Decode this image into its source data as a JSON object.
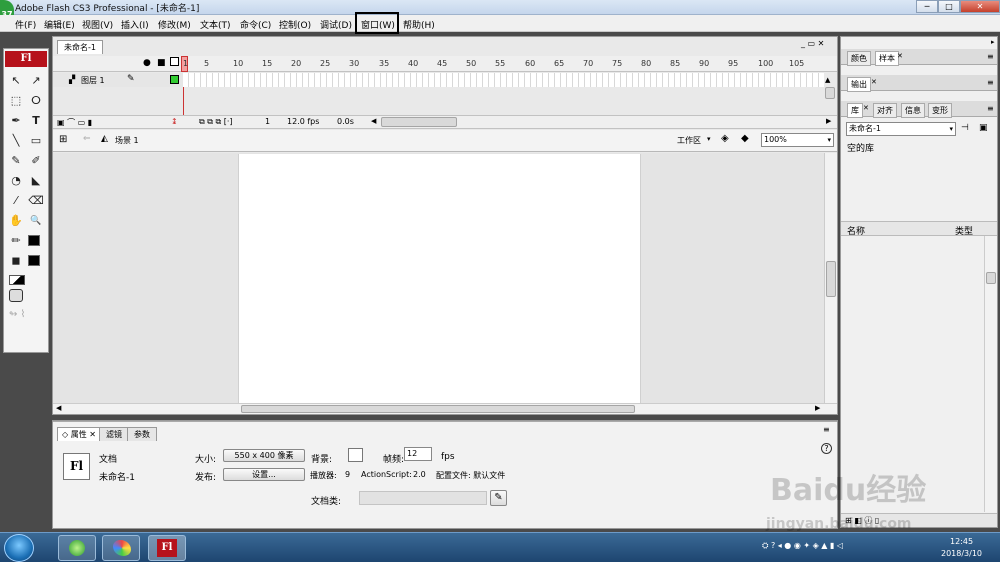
{
  "window": {
    "title": "Adobe Flash CS3 Professional - [未命名-1]",
    "badge": "37",
    "controls": [
      "─",
      "□",
      "✕"
    ]
  },
  "menu": [
    "件(F)",
    "编辑(E)",
    "视图(V)",
    "插入(I)",
    "修改(M)",
    "文本(T)",
    "命令(C)",
    "控制(O)",
    "调试(D)",
    "窗口(W)",
    "帮助(H)"
  ],
  "toolbox": {
    "logo": "Fl",
    "tools": [
      "arrow-icon",
      "subselect-icon",
      "free-transform-icon",
      "lasso-icon",
      "pen-icon",
      "text-icon",
      "line-icon",
      "rectangle-icon",
      "pencil-icon",
      "brush-icon",
      "ink-bottle-icon",
      "paint-bucket-icon",
      "eyedropper-icon",
      "eraser-icon",
      "hand-icon",
      "zoom-icon",
      "stroke-color-icon",
      "fill-color-icon"
    ],
    "glyphs": [
      "↖",
      "↗",
      "⬚",
      "ⵔ",
      "✒",
      "T",
      "╲",
      "▭",
      "✎",
      "✐",
      "◔",
      "◣",
      "⁄",
      "⌫",
      "✋",
      "🔍",
      "✏",
      "◼"
    ]
  },
  "document": {
    "tab": "未命名-1",
    "ruler_numbers": [
      "1",
      "5",
      "10",
      "15",
      "20",
      "25",
      "30",
      "35",
      "40",
      "45",
      "50",
      "55",
      "60",
      "65",
      "70",
      "75",
      "80",
      "85",
      "90",
      "95",
      "100",
      "105"
    ],
    "layer_name": "图层 1",
    "frame": "1",
    "fps": "12.0 fps",
    "time": "0.0s",
    "scene": "场景 1",
    "workspace": "工作区",
    "zoom": "100%"
  },
  "properties": {
    "tabs": [
      "属性",
      "滤镜",
      "参数"
    ],
    "doc_label": "文档",
    "doc_name": "未命名-1",
    "size_label": "大小:",
    "size_value": "550 x 400 像素",
    "bg_label": "背景:",
    "fps_label": "帧频:",
    "fps_value": "12",
    "fps_unit": "fps",
    "publish_label": "发布:",
    "settings_button": "设置...",
    "player_label": "播放器:",
    "player_value": "9",
    "as_label": "ActionScript:",
    "as_value": "2.0",
    "profile": "配置文件: 默认文件",
    "class_label": "文档类:",
    "fl_icon": "Fl",
    "help": "?"
  },
  "right_panel": {
    "top_tabs": [
      "颜色",
      "样本"
    ],
    "output_tab": "输出",
    "lib_tabs": [
      "库",
      "对齐",
      "信息",
      "变形"
    ],
    "library_select": "未命名-1",
    "empty_text": "空的库",
    "col_name": "名称",
    "col_type": "类型"
  },
  "taskbar": {
    "time": "12:45",
    "date": "2018/3/10",
    "fl": "Fl"
  },
  "watermark": {
    "logo": "Baidu经验",
    "url": "jingyan.baidu.com"
  }
}
